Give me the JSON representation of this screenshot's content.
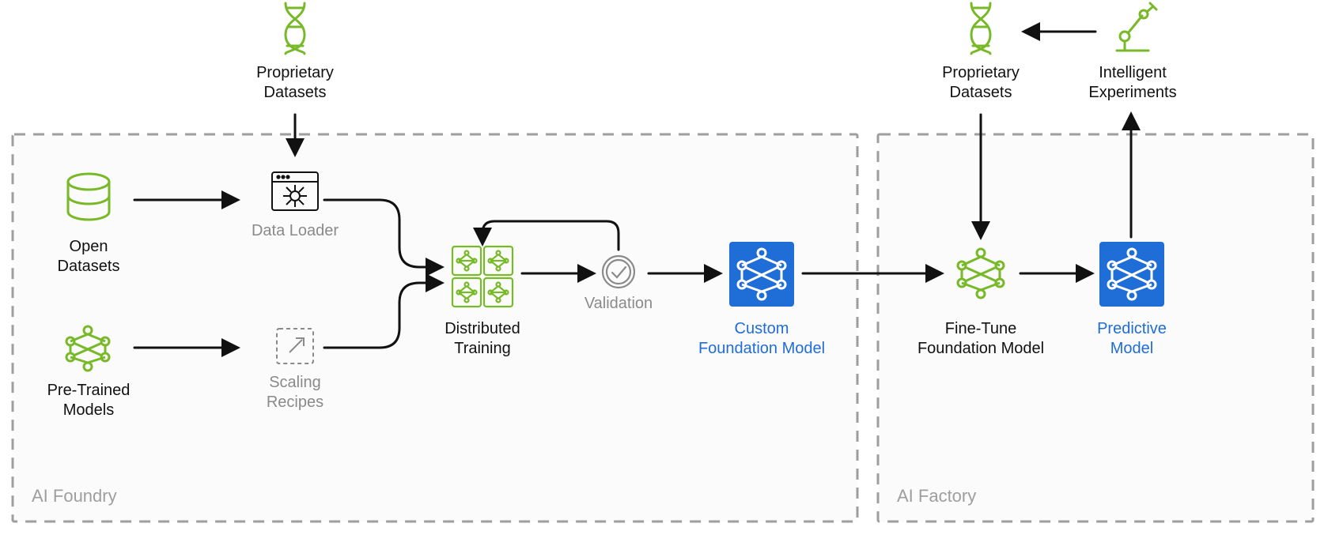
{
  "colors": {
    "green": "#78b928",
    "blue": "#1f6dd6",
    "gray": "#8a8a8a",
    "black": "#111111",
    "dash": "#9e9e9e",
    "panel": "#fbfbfb"
  },
  "panels": {
    "foundry": {
      "label": "AI Foundry"
    },
    "factory": {
      "label": "AI Factory"
    }
  },
  "nodes": {
    "proprietary_datasets_1": {
      "label": "Proprietary\nDatasets"
    },
    "open_datasets": {
      "label": "Open\nDatasets"
    },
    "pretrained_models": {
      "label": "Pre-Trained\nModels"
    },
    "data_loader": {
      "label": "Data Loader"
    },
    "scaling_recipes": {
      "label": "Scaling\nRecipes"
    },
    "distributed_training": {
      "label": "Distributed\nTraining"
    },
    "validation": {
      "label": "Validation"
    },
    "custom_foundation": {
      "label": "Custom\nFoundation Model"
    },
    "proprietary_datasets_2": {
      "label": "Proprietary\nDatasets"
    },
    "intelligent_experiments": {
      "label": "Intelligent\nExperiments"
    },
    "fine_tune": {
      "label": "Fine-Tune\nFoundation Model"
    },
    "predictive_model": {
      "label": "Predictive\nModel"
    }
  }
}
